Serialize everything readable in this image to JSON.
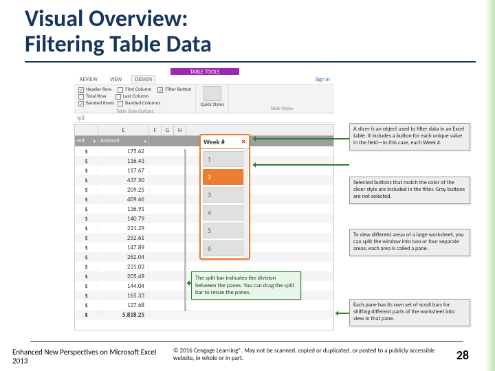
{
  "title_line1": "Visual Overview:",
  "title_line2": "Filtering Table Data",
  "ribbon": {
    "tools_title": "TABLE TOOLS",
    "tabs": {
      "review": "REVIEW",
      "view": "VIEW",
      "design": "DESIGN"
    },
    "signin": "Sign in",
    "opts": {
      "header_row": "Header Row",
      "first_col": "First Column",
      "filter_btn": "Filter Button",
      "total_row": "Total Row",
      "last_col": "Last Column",
      "banded_rows": "Banded Rows",
      "banded_cols": "Banded Columns"
    },
    "group_labels": {
      "style_opts": "Table Style Options",
      "styles": "Table Styles",
      "quick": "Quick Styles"
    }
  },
  "formula_hint": "(y))",
  "columns": {
    "col_b": "E",
    "col_c": "F",
    "col_d": "G",
    "col_e": "H"
  },
  "table": {
    "head1": "ent",
    "head2": "Amount",
    "currency": "$",
    "values": [
      "175.62",
      "116.43",
      "117.67",
      "437.50",
      "209.25",
      "409.66",
      "136.91",
      "140.79",
      "221.29",
      "252.61",
      "147.89",
      "262.04",
      "231.03",
      "205.49",
      "144.04",
      "165.33",
      "127.68"
    ],
    "total": "5,818.25"
  },
  "slicer": {
    "title": "Week #",
    "items": [
      "1",
      "2",
      "3",
      "4",
      "5",
      "6"
    ],
    "selected_index": 1
  },
  "callouts": {
    "slicer_def": "A slicer is an object used to filter data in an Excel table. It includes a button for each unique value in the field—in this case, each Week #.",
    "selected_btns": "Selected buttons that match the color of the slicer style are included in the filter. Gray buttons are not selected.",
    "split_large": "To view different areas of a large worksheet, you can split the window into two or four separate areas; each area is called a pane.",
    "split_bar": "The split bar indicates the division between the panes. You can drag the split bar to resize the panes.",
    "scroll_panes": "Each pane has its own set of scroll bars for shifting different parts of the worksheet into view in that pane."
  },
  "footer": {
    "left": "Enhanced New Perspectives on Microsoft Excel 2013",
    "mid": "© 2016 Cengage Learning®. May not be scanned, copied or duplicated, or posted to a publicly accessible website, in whole or in part.",
    "page": "28"
  }
}
